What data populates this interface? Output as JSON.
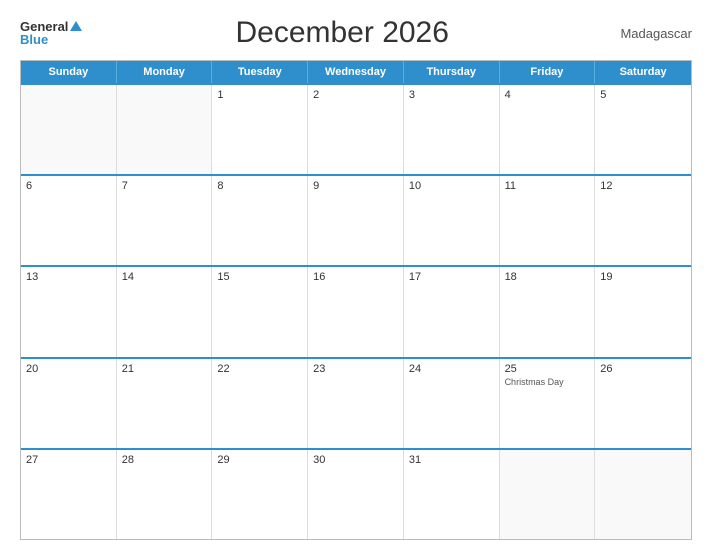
{
  "header": {
    "logo_general": "General",
    "logo_blue": "Blue",
    "title": "December 2026",
    "country": "Madagascar"
  },
  "days_of_week": [
    "Sunday",
    "Monday",
    "Tuesday",
    "Wednesday",
    "Thursday",
    "Friday",
    "Saturday"
  ],
  "weeks": [
    [
      {
        "day": "",
        "empty": true
      },
      {
        "day": "",
        "empty": true
      },
      {
        "day": "1"
      },
      {
        "day": "2"
      },
      {
        "day": "3"
      },
      {
        "day": "4"
      },
      {
        "day": "5"
      }
    ],
    [
      {
        "day": "6"
      },
      {
        "day": "7"
      },
      {
        "day": "8"
      },
      {
        "day": "9"
      },
      {
        "day": "10"
      },
      {
        "day": "11"
      },
      {
        "day": "12"
      }
    ],
    [
      {
        "day": "13"
      },
      {
        "day": "14"
      },
      {
        "day": "15"
      },
      {
        "day": "16"
      },
      {
        "day": "17"
      },
      {
        "day": "18"
      },
      {
        "day": "19"
      }
    ],
    [
      {
        "day": "20"
      },
      {
        "day": "21"
      },
      {
        "day": "22"
      },
      {
        "day": "23"
      },
      {
        "day": "24"
      },
      {
        "day": "25",
        "holiday": "Christmas Day"
      },
      {
        "day": "26"
      }
    ],
    [
      {
        "day": "27"
      },
      {
        "day": "28"
      },
      {
        "day": "29"
      },
      {
        "day": "30"
      },
      {
        "day": "31"
      },
      {
        "day": "",
        "empty": true
      },
      {
        "day": "",
        "empty": true
      }
    ]
  ]
}
